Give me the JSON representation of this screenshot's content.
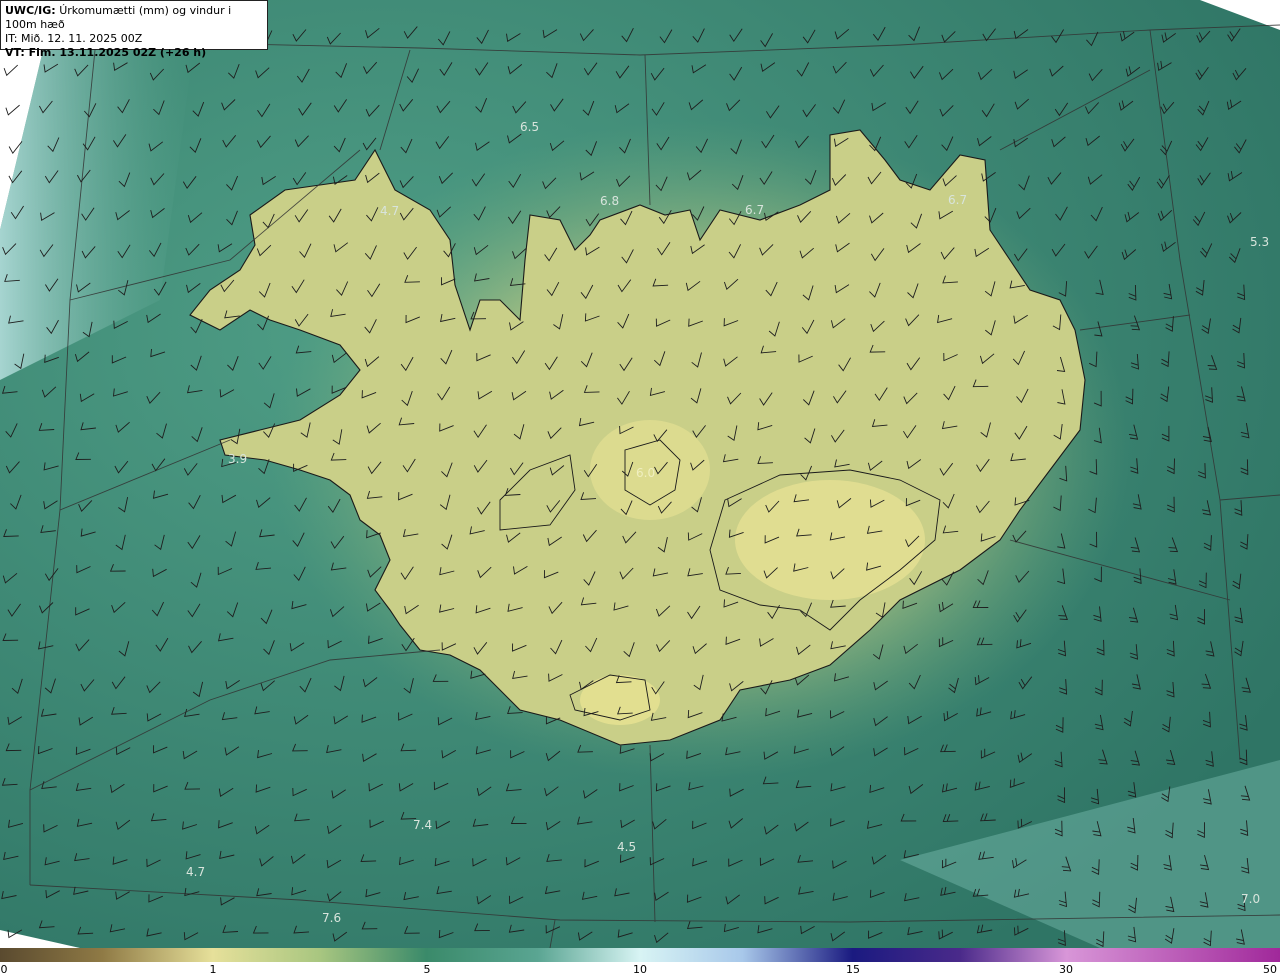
{
  "header": {
    "model_label": "UWC/IG:",
    "field_title": "Úrkomumætti (mm) og vindur i 100m hæð",
    "init_time": "IT: Mið. 12. 11. 2025 00Z",
    "valid_time": "VT: Fim. 13.11.2025 02Z (+26 h)"
  },
  "colorbar": {
    "ticks": [
      "0",
      "1",
      "5",
      "10",
      "15",
      "30",
      "50"
    ],
    "colors": [
      "#5a4a2f",
      "#b09a5a",
      "#e6e09a",
      "#c8d58a",
      "#3a8a6a",
      "#2f7a6a",
      "#9ed6d6",
      "#d8f4f4",
      "#c0d8f0",
      "#3a4ab0",
      "#1a1a80",
      "#6a2a8a",
      "#d080d0",
      "#b03aa0"
    ]
  },
  "map": {
    "land_color": "#d6d890",
    "sea_color": "#3f8b77",
    "values": [
      {
        "name": "value-6-5",
        "text": "6.5"
      },
      {
        "name": "value-4-7-nw",
        "text": "4.7"
      },
      {
        "name": "value-6-8",
        "text": "6.8"
      },
      {
        "name": "value-6-7-n",
        "text": "6.7"
      },
      {
        "name": "value-6-7-ne",
        "text": "6.7"
      },
      {
        "name": "value-5-3",
        "text": "5.3"
      },
      {
        "name": "value-3-9",
        "text": "3.9"
      },
      {
        "name": "value-6-0",
        "text": "6.0"
      },
      {
        "name": "value-7-4",
        "text": "7.4"
      },
      {
        "name": "value-4-5",
        "text": "4.5"
      },
      {
        "name": "value-4-7-sw",
        "text": "4.7"
      },
      {
        "name": "value-7-6",
        "text": "7.6"
      },
      {
        "name": "value-7-0",
        "text": "7.0"
      }
    ]
  }
}
